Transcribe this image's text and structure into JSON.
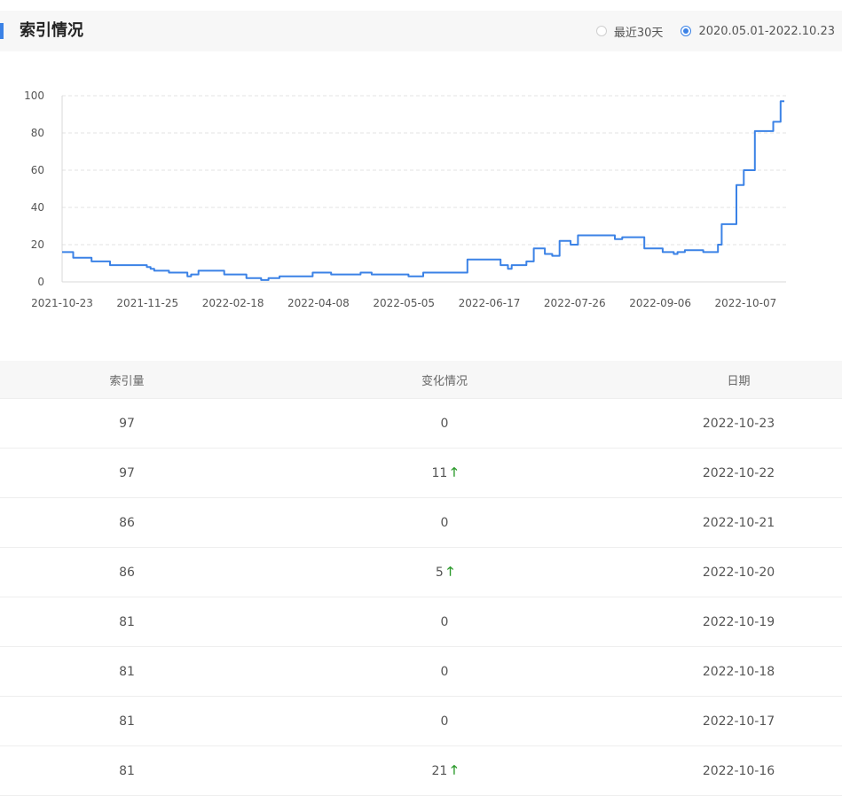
{
  "header": {
    "title": "索引情况",
    "range_options": [
      {
        "label": "最近30天",
        "selected": false
      },
      {
        "label": "2020.05.01-2022.10.23",
        "selected": true
      }
    ]
  },
  "chart_data": {
    "type": "line",
    "series_color": "#3b82e6",
    "ylim": [
      0,
      100
    ],
    "yticks": [
      0,
      20,
      40,
      60,
      80,
      100
    ],
    "grid": true,
    "xtick_labels": [
      "2021-10-23",
      "2021-11-25",
      "2022-02-18",
      "2022-04-08",
      "2022-05-05",
      "2022-06-17",
      "2022-07-26",
      "2022-09-06",
      "2022-10-07"
    ],
    "values": [
      16,
      16,
      16,
      13,
      13,
      13,
      13,
      13,
      11,
      11,
      11,
      11,
      11,
      9,
      9,
      9,
      9,
      9,
      9,
      9,
      9,
      9,
      9,
      8,
      7,
      6,
      6,
      6,
      6,
      5,
      5,
      5,
      5,
      5,
      3,
      4,
      4,
      6,
      6,
      6,
      6,
      6,
      6,
      6,
      4,
      4,
      4,
      4,
      4,
      4,
      2,
      2,
      2,
      2,
      1,
      1,
      2,
      2,
      2,
      3,
      3,
      3,
      3,
      3,
      3,
      3,
      3,
      3,
      5,
      5,
      5,
      5,
      5,
      4,
      4,
      4,
      4,
      4,
      4,
      4,
      4,
      5,
      5,
      5,
      4,
      4,
      4,
      4,
      4,
      4,
      4,
      4,
      4,
      4,
      3,
      3,
      3,
      3,
      5,
      5,
      5,
      5,
      5,
      5,
      5,
      5,
      5,
      5,
      5,
      5,
      12,
      12,
      12,
      12,
      12,
      12,
      12,
      12,
      12,
      9,
      9,
      7,
      9,
      9,
      9,
      9,
      11,
      11,
      18,
      18,
      18,
      15,
      15,
      14,
      14,
      22,
      22,
      22,
      20,
      20,
      25,
      25,
      25,
      25,
      25,
      25,
      25,
      25,
      25,
      25,
      23,
      23,
      24,
      24,
      24,
      24,
      24,
      24,
      18,
      18,
      18,
      18,
      18,
      16,
      16,
      16,
      15,
      16,
      16,
      17,
      17,
      17,
      17,
      17,
      16,
      16,
      16,
      16,
      20,
      31,
      31,
      31,
      31,
      52,
      52,
      60,
      60,
      60,
      81,
      81,
      81,
      81,
      81,
      86,
      86,
      97,
      97
    ]
  },
  "table": {
    "headers": [
      "索引量",
      "变化情况",
      "日期"
    ],
    "rows": [
      {
        "index": "97",
        "change": "0",
        "up": false,
        "date": "2022-10-23"
      },
      {
        "index": "97",
        "change": "11",
        "up": true,
        "date": "2022-10-22"
      },
      {
        "index": "86",
        "change": "0",
        "up": false,
        "date": "2022-10-21"
      },
      {
        "index": "86",
        "change": "5",
        "up": true,
        "date": "2022-10-20"
      },
      {
        "index": "81",
        "change": "0",
        "up": false,
        "date": "2022-10-19"
      },
      {
        "index": "81",
        "change": "0",
        "up": false,
        "date": "2022-10-18"
      },
      {
        "index": "81",
        "change": "0",
        "up": false,
        "date": "2022-10-17"
      },
      {
        "index": "81",
        "change": "21",
        "up": true,
        "date": "2022-10-16"
      }
    ]
  }
}
